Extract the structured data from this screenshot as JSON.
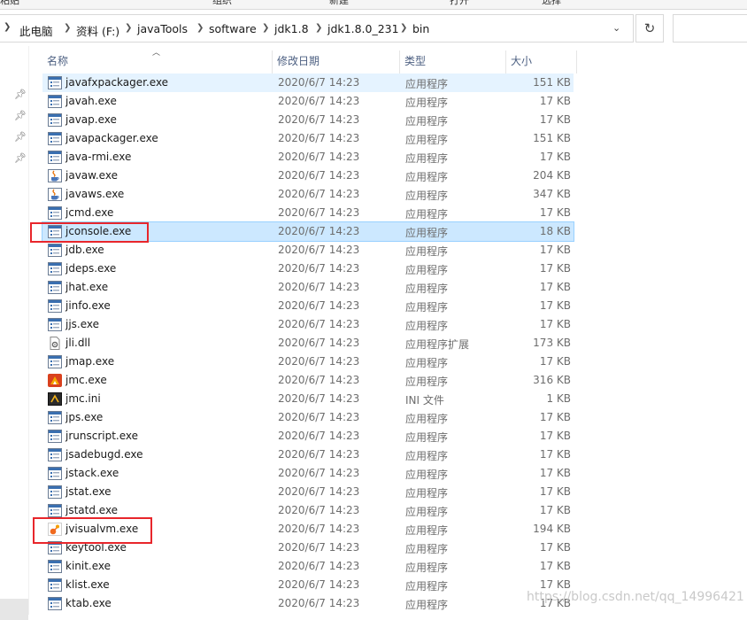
{
  "ribbon": {
    "labels": [
      "粘贴",
      "组织",
      "新建",
      "打开",
      "选择"
    ]
  },
  "address_bar": {
    "breadcrumbs": [
      "此电脑",
      "资料 (F:)",
      "javaTools",
      "software",
      "jdk1.8",
      "jdk1.8.0_231",
      "bin"
    ]
  },
  "columns": {
    "name": "名称",
    "date": "修改日期",
    "type": "类型",
    "size": "大小"
  },
  "files": [
    {
      "name": "javafxpackager.exe",
      "date": "2020/6/7 14:23",
      "type": "应用程序",
      "size": "151 KB",
      "icon": "exe-window-icon"
    },
    {
      "name": "javah.exe",
      "date": "2020/6/7 14:23",
      "type": "应用程序",
      "size": "17 KB",
      "icon": "exe-window-icon"
    },
    {
      "name": "javap.exe",
      "date": "2020/6/7 14:23",
      "type": "应用程序",
      "size": "17 KB",
      "icon": "exe-window-icon"
    },
    {
      "name": "javapackager.exe",
      "date": "2020/6/7 14:23",
      "type": "应用程序",
      "size": "151 KB",
      "icon": "exe-window-icon"
    },
    {
      "name": "java-rmi.exe",
      "date": "2020/6/7 14:23",
      "type": "应用程序",
      "size": "17 KB",
      "icon": "exe-window-icon"
    },
    {
      "name": "javaw.exe",
      "date": "2020/6/7 14:23",
      "type": "应用程序",
      "size": "204 KB",
      "icon": "java-cup-icon"
    },
    {
      "name": "javaws.exe",
      "date": "2020/6/7 14:23",
      "type": "应用程序",
      "size": "347 KB",
      "icon": "java-cup-icon"
    },
    {
      "name": "jcmd.exe",
      "date": "2020/6/7 14:23",
      "type": "应用程序",
      "size": "17 KB",
      "icon": "exe-window-icon"
    },
    {
      "name": "jconsole.exe",
      "date": "2020/6/7 14:23",
      "type": "应用程序",
      "size": "18 KB",
      "icon": "exe-window-icon"
    },
    {
      "name": "jdb.exe",
      "date": "2020/6/7 14:23",
      "type": "应用程序",
      "size": "17 KB",
      "icon": "exe-window-icon"
    },
    {
      "name": "jdeps.exe",
      "date": "2020/6/7 14:23",
      "type": "应用程序",
      "size": "17 KB",
      "icon": "exe-window-icon"
    },
    {
      "name": "jhat.exe",
      "date": "2020/6/7 14:23",
      "type": "应用程序",
      "size": "17 KB",
      "icon": "exe-window-icon"
    },
    {
      "name": "jinfo.exe",
      "date": "2020/6/7 14:23",
      "type": "应用程序",
      "size": "17 KB",
      "icon": "exe-window-icon"
    },
    {
      "name": "jjs.exe",
      "date": "2020/6/7 14:23",
      "type": "应用程序",
      "size": "17 KB",
      "icon": "exe-window-icon"
    },
    {
      "name": "jli.dll",
      "date": "2020/6/7 14:23",
      "type": "应用程序扩展",
      "size": "173 KB",
      "icon": "dll-gear-icon"
    },
    {
      "name": "jmap.exe",
      "date": "2020/6/7 14:23",
      "type": "应用程序",
      "size": "17 KB",
      "icon": "exe-window-icon"
    },
    {
      "name": "jmc.exe",
      "date": "2020/6/7 14:23",
      "type": "应用程序",
      "size": "316 KB",
      "icon": "jmc-app-icon"
    },
    {
      "name": "jmc.ini",
      "date": "2020/6/7 14:23",
      "type": "INI 文件",
      "size": "1 KB",
      "icon": "ini-settings-icon"
    },
    {
      "name": "jps.exe",
      "date": "2020/6/7 14:23",
      "type": "应用程序",
      "size": "17 KB",
      "icon": "exe-window-icon"
    },
    {
      "name": "jrunscript.exe",
      "date": "2020/6/7 14:23",
      "type": "应用程序",
      "size": "17 KB",
      "icon": "exe-window-icon"
    },
    {
      "name": "jsadebugd.exe",
      "date": "2020/6/7 14:23",
      "type": "应用程序",
      "size": "17 KB",
      "icon": "exe-window-icon"
    },
    {
      "name": "jstack.exe",
      "date": "2020/6/7 14:23",
      "type": "应用程序",
      "size": "17 KB",
      "icon": "exe-window-icon"
    },
    {
      "name": "jstat.exe",
      "date": "2020/6/7 14:23",
      "type": "应用程序",
      "size": "17 KB",
      "icon": "exe-window-icon"
    },
    {
      "name": "jstatd.exe",
      "date": "2020/6/7 14:23",
      "type": "应用程序",
      "size": "17 KB",
      "icon": "exe-window-icon"
    },
    {
      "name": "jvisualvm.exe",
      "date": "2020/6/7 14:23",
      "type": "应用程序",
      "size": "194 KB",
      "icon": "visualvm-icon"
    },
    {
      "name": "keytool.exe",
      "date": "2020/6/7 14:23",
      "type": "应用程序",
      "size": "17 KB",
      "icon": "exe-window-icon"
    },
    {
      "name": "kinit.exe",
      "date": "2020/6/7 14:23",
      "type": "应用程序",
      "size": "17 KB",
      "icon": "exe-window-icon"
    },
    {
      "name": "klist.exe",
      "date": "2020/6/7 14:23",
      "type": "应用程序",
      "size": "17 KB",
      "icon": "exe-window-icon"
    },
    {
      "name": "ktab.exe",
      "date": "2020/6/7 14:23",
      "type": "应用程序",
      "size": "17 KB",
      "icon": "exe-window-icon"
    }
  ],
  "row_states": {
    "hover": "javafxpackager.exe",
    "selected": "jconsole.exe"
  },
  "annotations": {
    "highlighted_files": [
      "jconsole.exe",
      "jvisualvm.exe"
    ],
    "color": "#e8262b"
  },
  "watermark": "https://blog.csdn.net/qq_14996421"
}
